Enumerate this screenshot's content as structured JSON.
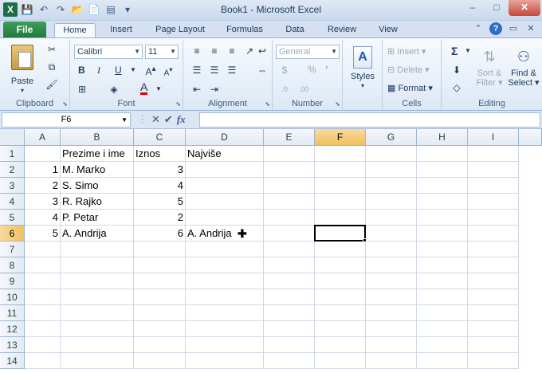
{
  "window": {
    "title": "Book1  -  Microsoft Excel",
    "minimize": "–",
    "maximize": "□",
    "close": "✕"
  },
  "tabs": [
    "File",
    "Home",
    "Insert",
    "Page Layout",
    "Formulas",
    "Data",
    "Review",
    "View"
  ],
  "active_tab": "Home",
  "ribbon": {
    "clipboard": {
      "label": "Clipboard",
      "paste": "Paste"
    },
    "font": {
      "label": "Font",
      "name": "Calibri",
      "size": "11",
      "bold": "B",
      "italic": "I",
      "underline": "U",
      "font_color_letter": "A"
    },
    "alignment": {
      "label": "Alignment"
    },
    "number": {
      "label": "Number",
      "format": "General",
      "percent": "%",
      "comma": "’"
    },
    "styles": {
      "label": "Styles"
    },
    "cells": {
      "label": "Cells",
      "insert": "Insert",
      "delete": "Delete",
      "format": "Format"
    },
    "editing": {
      "label": "Editing",
      "sigma": "Σ",
      "sort": "Sort &",
      "sort2": "Filter",
      "find": "Find &",
      "find2": "Select"
    }
  },
  "formula_bar": {
    "name_box": "F6",
    "cancel": "✕",
    "enter": "✔",
    "fx": "fx",
    "formula": ""
  },
  "grid": {
    "columns": [
      "A",
      "B",
      "C",
      "D",
      "E",
      "F",
      "G",
      "H",
      "I"
    ],
    "selected_column": "F",
    "rows": [
      "1",
      "2",
      "3",
      "4",
      "5",
      "6",
      "7",
      "8",
      "9",
      "10",
      "11",
      "12",
      "13",
      "14"
    ],
    "selected_row": "6",
    "cells": [
      {
        "r": 1,
        "c": "B",
        "v": "Prezime i ime",
        "num": false
      },
      {
        "r": 1,
        "c": "C",
        "v": "Iznos",
        "num": false
      },
      {
        "r": 1,
        "c": "D",
        "v": "Najviše",
        "num": false
      },
      {
        "r": 2,
        "c": "A",
        "v": "1",
        "num": true
      },
      {
        "r": 2,
        "c": "B",
        "v": "M. Marko",
        "num": false
      },
      {
        "r": 2,
        "c": "C",
        "v": "3",
        "num": true
      },
      {
        "r": 3,
        "c": "A",
        "v": "2",
        "num": true
      },
      {
        "r": 3,
        "c": "B",
        "v": "S. Simo",
        "num": false
      },
      {
        "r": 3,
        "c": "C",
        "v": "4",
        "num": true
      },
      {
        "r": 4,
        "c": "A",
        "v": "3",
        "num": true
      },
      {
        "r": 4,
        "c": "B",
        "v": "R. Rajko",
        "num": false
      },
      {
        "r": 4,
        "c": "C",
        "v": "5",
        "num": true
      },
      {
        "r": 5,
        "c": "A",
        "v": "4",
        "num": true
      },
      {
        "r": 5,
        "c": "B",
        "v": "P. Petar",
        "num": false
      },
      {
        "r": 5,
        "c": "C",
        "v": "2",
        "num": true
      },
      {
        "r": 6,
        "c": "A",
        "v": "5",
        "num": true
      },
      {
        "r": 6,
        "c": "B",
        "v": "A. Andrija",
        "num": false
      },
      {
        "r": 6,
        "c": "C",
        "v": "6",
        "num": true
      },
      {
        "r": 6,
        "c": "D",
        "v": "A. Andrija",
        "num": false
      }
    ]
  }
}
